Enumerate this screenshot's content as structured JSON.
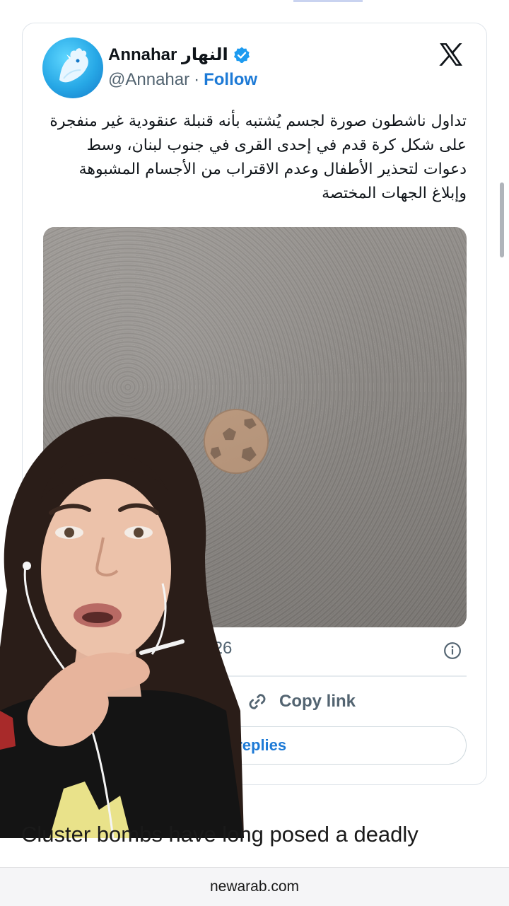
{
  "tweet": {
    "display_name": "Annahar النهار",
    "handle": "@Annahar",
    "separator": "·",
    "follow_label": "Follow",
    "text": "تداول ناشطون صورة لجسم يُشتبه بأنه قنبلة عنقودية غير منفجرة على شكل كرة قدم في إحدى القرى في جنوب لبنان، وسط دعوات لتحذير الأطفال وعدم الاقتراب من الأجسام المشبوهة وإبلاغ الجهات المختصة",
    "date_visible": "2026",
    "copy_link_label": "Copy link",
    "replies_label": "2 replies"
  },
  "article": {
    "line1": "Cluster bombs have long posed a deadly"
  },
  "browser": {
    "url": "newarab.com"
  },
  "colors": {
    "link_blue": "#1d7ad6",
    "verified_blue": "#1d9bf0",
    "muted_gray": "#536471"
  },
  "icons": [
    "verified-icon",
    "x-logo-icon",
    "info-icon",
    "link-icon"
  ]
}
